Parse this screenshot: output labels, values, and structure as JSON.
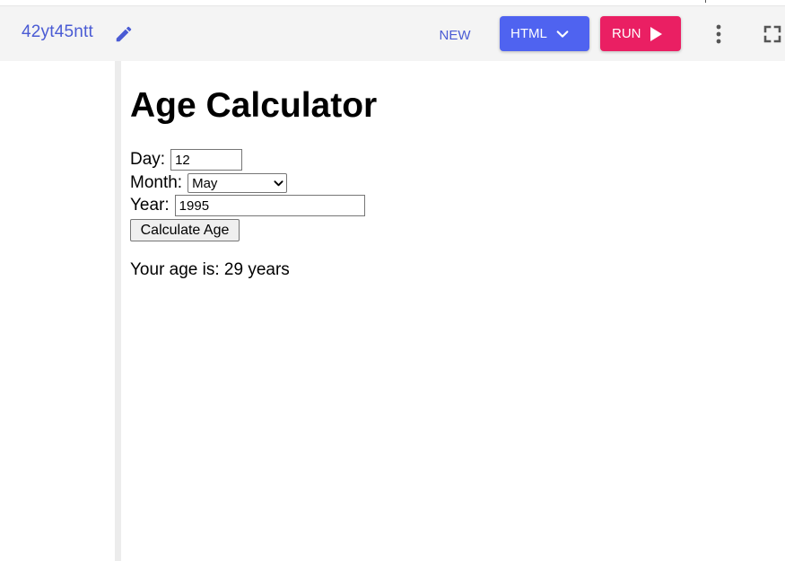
{
  "toolbar": {
    "project_name": "42yt45ntt",
    "edit_icon": "pencil-icon",
    "new_label": "NEW",
    "language_label": "HTML",
    "run_label": "RUN",
    "more_icon": "vertical-dots-icon",
    "fullscreen_icon": "fullscreen-icon",
    "accent_color": "#4f63f0",
    "run_color": "#ea1f63"
  },
  "preview": {
    "heading": "Age Calculator",
    "day_label": "Day:",
    "day_value": "12",
    "month_label": "Month:",
    "month_selected": "May",
    "year_label": "Year:",
    "year_value": "1995",
    "calculate_label": "Calculate Age",
    "result_text": "Your age is: 29 years"
  }
}
